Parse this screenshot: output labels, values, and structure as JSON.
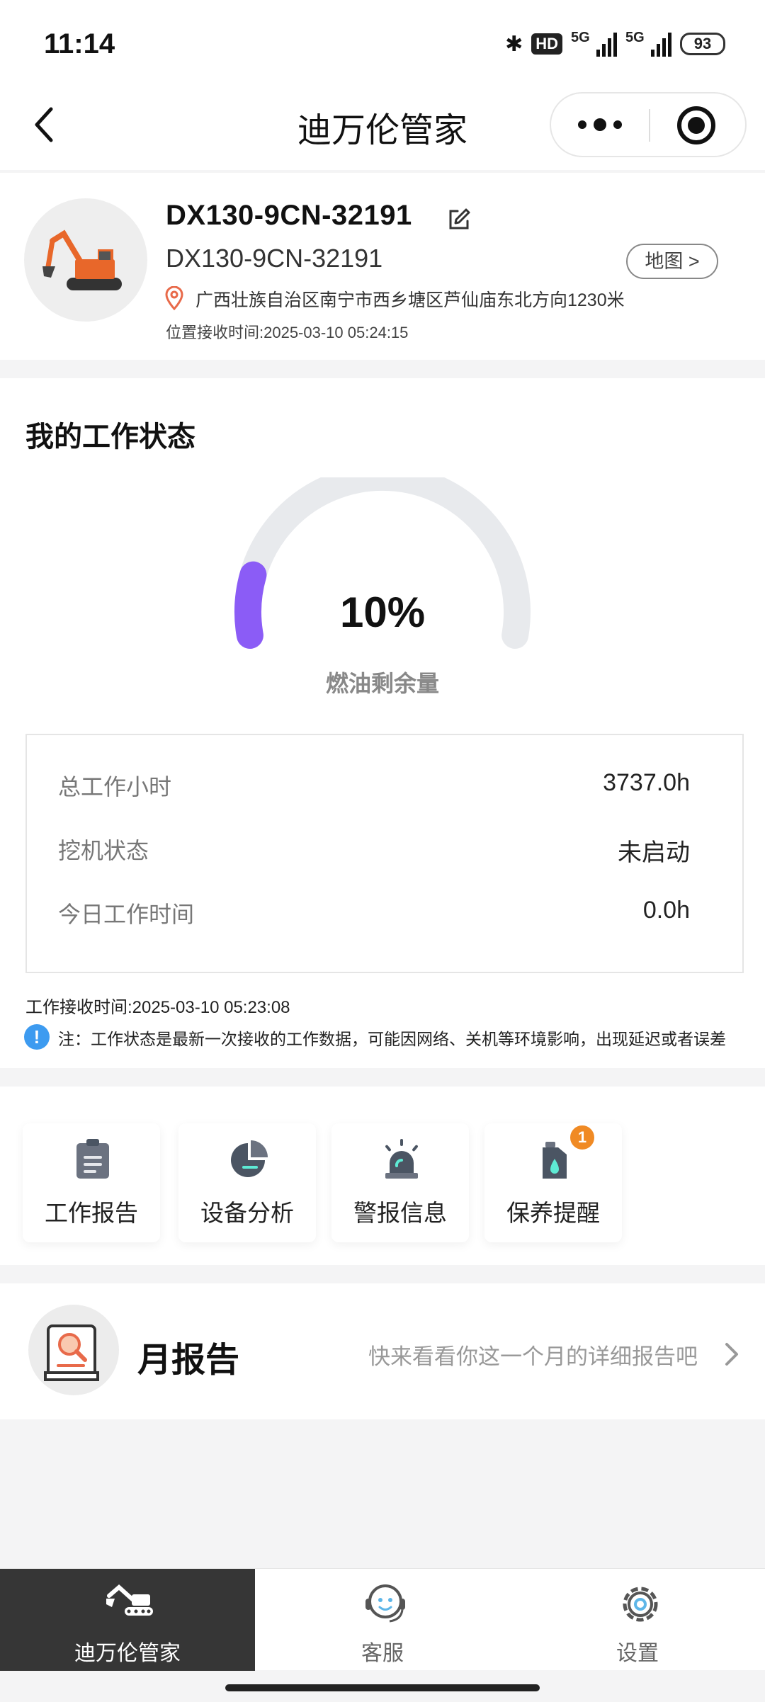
{
  "status_bar": {
    "time": "11:14",
    "hd": "HD",
    "network_1": "5G",
    "network_2": "5G",
    "battery": "93"
  },
  "nav": {
    "title": "迪万伦管家"
  },
  "device": {
    "name": "DX130-9CN-32191",
    "model": "DX130-9CN-32191",
    "map_button": "地图 >",
    "address": "广西壮族自治区南宁市西乡塘区芦仙庙东北方向1230米",
    "location_time": "位置接收时间:2025-03-10 05:24:15"
  },
  "work_status": {
    "title": "我的工作状态",
    "fuel": {
      "value_text": "10%",
      "fraction": 0.1,
      "label": "燃油剩余量",
      "color": "#8b5cf6",
      "track_color": "#e8eaed"
    },
    "stats": [
      {
        "label": "总工作小时",
        "value": "3737.0h"
      },
      {
        "label": "挖机状态",
        "value": "未启动"
      },
      {
        "label": "今日工作时间",
        "value": "0.0h"
      }
    ],
    "work_time": "工作接收时间:2025-03-10 05:23:08",
    "note_icon": "!",
    "note": "注：工作状态是最新一次接收的工作数据，可能因网络、关机等环境影响，出现延迟或者误差"
  },
  "menu": {
    "items": [
      {
        "label": "工作报告",
        "icon": "clipboard-icon"
      },
      {
        "label": "设备分析",
        "icon": "pie-chart-icon"
      },
      {
        "label": "警报信息",
        "icon": "alarm-light-icon"
      },
      {
        "label": "保养提醒",
        "icon": "oil-can-icon",
        "badge": "1"
      }
    ]
  },
  "monthly_report": {
    "title": "月报告",
    "hint": "快来看看你这一个月的详细报告吧"
  },
  "tab_bar": {
    "tabs": [
      {
        "label": "迪万伦管家",
        "icon": "excavator-icon",
        "active": true
      },
      {
        "label": "客服",
        "icon": "customer-service-icon",
        "active": false
      },
      {
        "label": "设置",
        "icon": "gear-icon",
        "active": false
      }
    ]
  },
  "colors": {
    "accent": "#8b5cf6",
    "tab_active_bg": "#363636",
    "badge": "#f08a24",
    "info": "#3d9bf0"
  }
}
